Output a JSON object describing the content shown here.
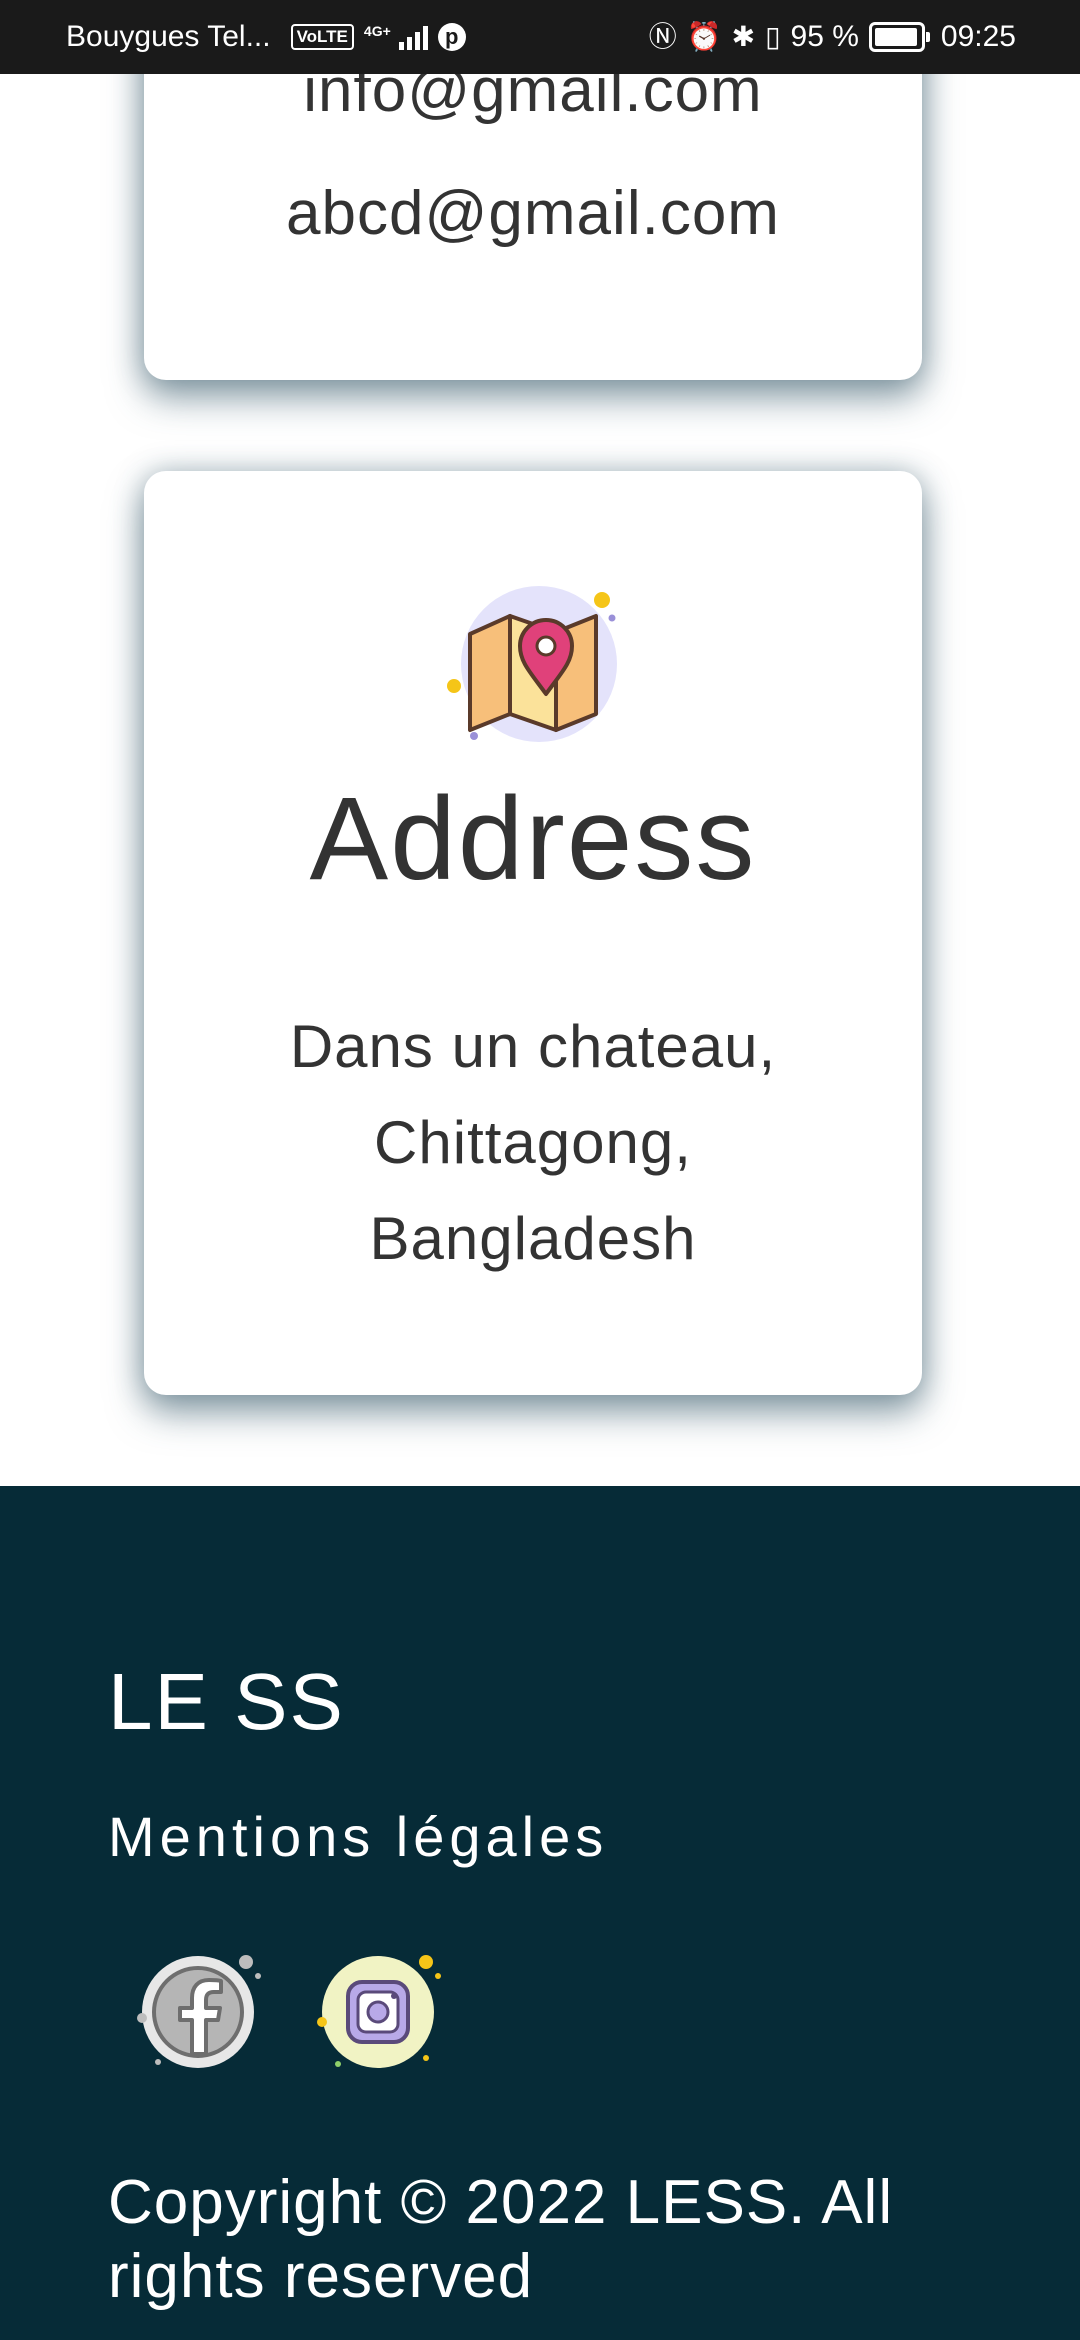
{
  "status_bar": {
    "carrier": "Bouygues Tel...",
    "volte": "VoLTE",
    "network": "4G+",
    "battery_percent": "95 %",
    "battery_level": 0.95,
    "time": "09:25"
  },
  "email_card": {
    "emails": [
      "info@gmail.com",
      "abcd@gmail.com"
    ]
  },
  "address_card": {
    "icon": "map-pin-icon",
    "title": "Address",
    "lines": [
      "Dans un chateau,",
      "Chittagong,",
      "Bangladesh"
    ]
  },
  "footer": {
    "brand": "LE SS",
    "legal_link": "Mentions légales",
    "social": [
      {
        "icon": "facebook-icon"
      },
      {
        "icon": "instagram-icon"
      }
    ],
    "copyright": "Copyright © 2022 LESS. All rights reserved",
    "background_color": "#062b37"
  }
}
